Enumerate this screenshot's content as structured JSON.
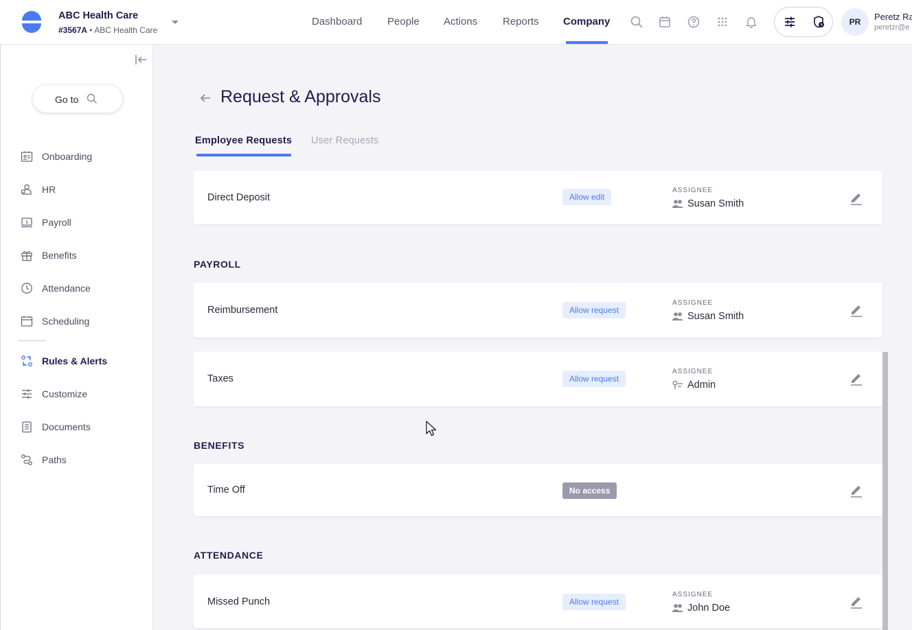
{
  "header": {
    "company_name": "ABC Health Care",
    "company_id": "#3567A",
    "company_separator": "•",
    "company_sub": "ABC Health Care",
    "nav": [
      "Dashboard",
      "People",
      "Actions",
      "Reports",
      "Company"
    ],
    "active_nav": "Company",
    "user_initials": "PR",
    "user_name": "Peretz Ra",
    "user_email": "peretzr@e"
  },
  "sidebar": {
    "goto_label": "Go to",
    "items": [
      {
        "label": "Onboarding",
        "icon": "onboarding-icon"
      },
      {
        "label": "HR",
        "icon": "hr-icon"
      },
      {
        "label": "Payroll",
        "icon": "payroll-icon"
      },
      {
        "label": "Benefits",
        "icon": "gift-icon"
      },
      {
        "label": "Attendance",
        "icon": "clock-icon"
      },
      {
        "label": "Scheduling",
        "icon": "calendar-icon"
      },
      {
        "label": "Rules & Alerts",
        "icon": "rules-icon"
      },
      {
        "label": "Customize",
        "icon": "sliders-icon"
      },
      {
        "label": "Documents",
        "icon": "documents-icon"
      },
      {
        "label": "Paths",
        "icon": "paths-icon"
      }
    ],
    "active_item": "Rules & Alerts"
  },
  "main": {
    "title": "Request & Approvals",
    "tabs": [
      "Employee Requests",
      "User Requests"
    ],
    "active_tab": "Employee Requests",
    "assignee_caption": "ASSIGNEE",
    "sections": [
      {
        "title": "",
        "rows": [
          {
            "label": "Direct Deposit",
            "badge": "Allow edit",
            "assignee": "Susan Smith",
            "assignee_icon": "people-icon"
          }
        ]
      },
      {
        "title": "PAYROLL",
        "rows": [
          {
            "label": "Reimbursement",
            "badge": "Allow request",
            "assignee": "Susan Smith",
            "assignee_icon": "people-icon"
          },
          {
            "label": "Taxes",
            "badge": "Allow request",
            "assignee": "Admin",
            "assignee_icon": "key-icon"
          }
        ]
      },
      {
        "title": "BENEFITS",
        "rows": [
          {
            "label": "Time Off",
            "badge": "No access",
            "assignee": "",
            "assignee_icon": ""
          }
        ]
      },
      {
        "title": "ATTENDANCE",
        "rows": [
          {
            "label": "Missed Punch",
            "badge": "Allow request",
            "assignee": "John Doe",
            "assignee_icon": "people-icon"
          }
        ]
      }
    ]
  },
  "colors": {
    "accent": "#4a7bf0",
    "navy": "#1e1e4b",
    "badge_allow_bg": "#e6eefc",
    "badge_noaccess_bg": "#9a9aac"
  }
}
